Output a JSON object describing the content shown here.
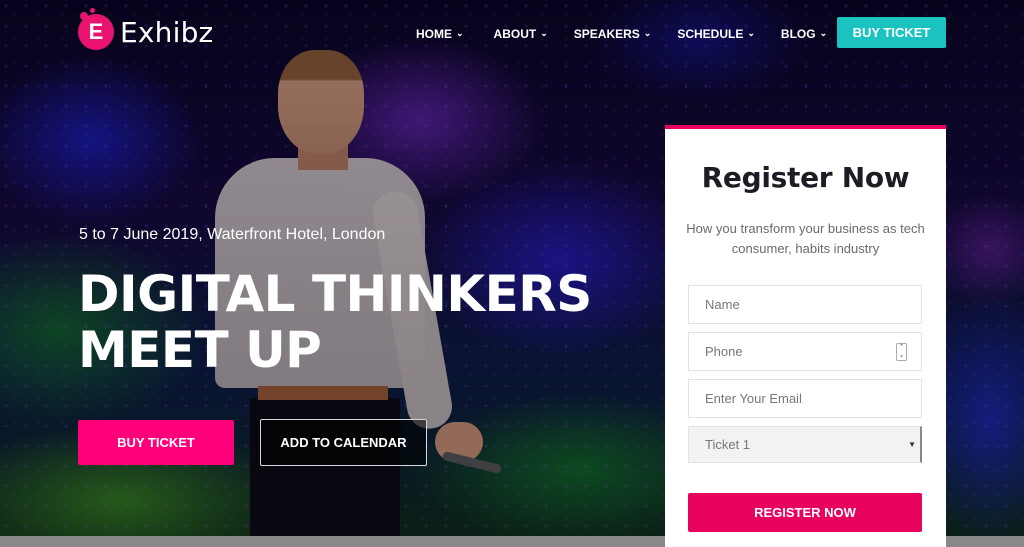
{
  "brand": {
    "name": "Exhibz",
    "logo_letter": "E",
    "accent": "#e8146f"
  },
  "nav": {
    "items": [
      {
        "label": "HOME",
        "icon": "chevron-down-icon"
      },
      {
        "label": "ABOUT",
        "icon": "chevron-down-icon"
      },
      {
        "label": "SPEAKERS",
        "icon": "chevron-down-icon"
      },
      {
        "label": "SCHEDULE",
        "icon": "chevron-down-icon"
      },
      {
        "label": "BLOG",
        "icon": "chevron-down-icon"
      }
    ],
    "chevron": "⌄",
    "cta_label": "BUY TICKET",
    "cta_color": "#1bc3c0"
  },
  "hero": {
    "meta": "5 to 7 June 2019, Waterfront Hotel, London",
    "title_line1": "DIGITAL THINKERS",
    "title_line2": "MEET UP",
    "buy_label": "BUY TICKET",
    "buy_color": "#ff007a",
    "calendar_label": "ADD TO CALENDAR"
  },
  "register": {
    "title": "Register Now",
    "subtitle": "How you transform your business as tech consumer, habits industry",
    "name_placeholder": "Name",
    "phone_placeholder": "Phone",
    "email_placeholder": "Enter Your Email",
    "ticket_selected": "Ticket 1",
    "submit_label": "REGISTER NOW",
    "accent": "#e8035f"
  }
}
